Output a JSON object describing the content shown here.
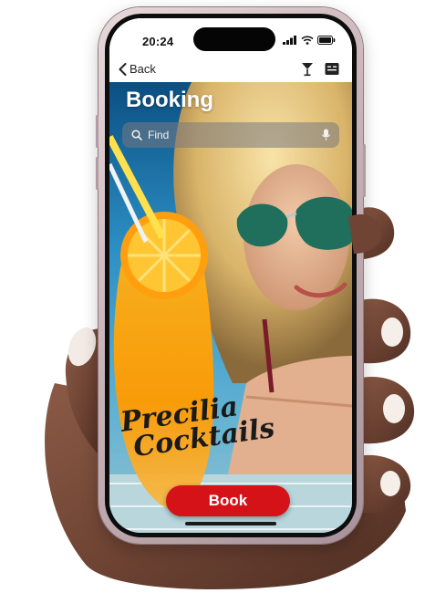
{
  "status_bar": {
    "time": "20:24"
  },
  "nav": {
    "back_label": "Back",
    "icons": [
      "chevron-left-icon",
      "cocktail-glass-icon",
      "menu-board-icon"
    ]
  },
  "page": {
    "title": "Booking"
  },
  "search": {
    "placeholder": "Find",
    "icons": [
      "search-icon",
      "microphone-icon"
    ]
  },
  "brand": {
    "line1": "Precilia",
    "line2": "Cocktails"
  },
  "actions": {
    "book_label": "Book"
  },
  "colors": {
    "book_button": "#d51217",
    "title_text": "#ffffff",
    "phone_frame": "#c8b3b8"
  }
}
